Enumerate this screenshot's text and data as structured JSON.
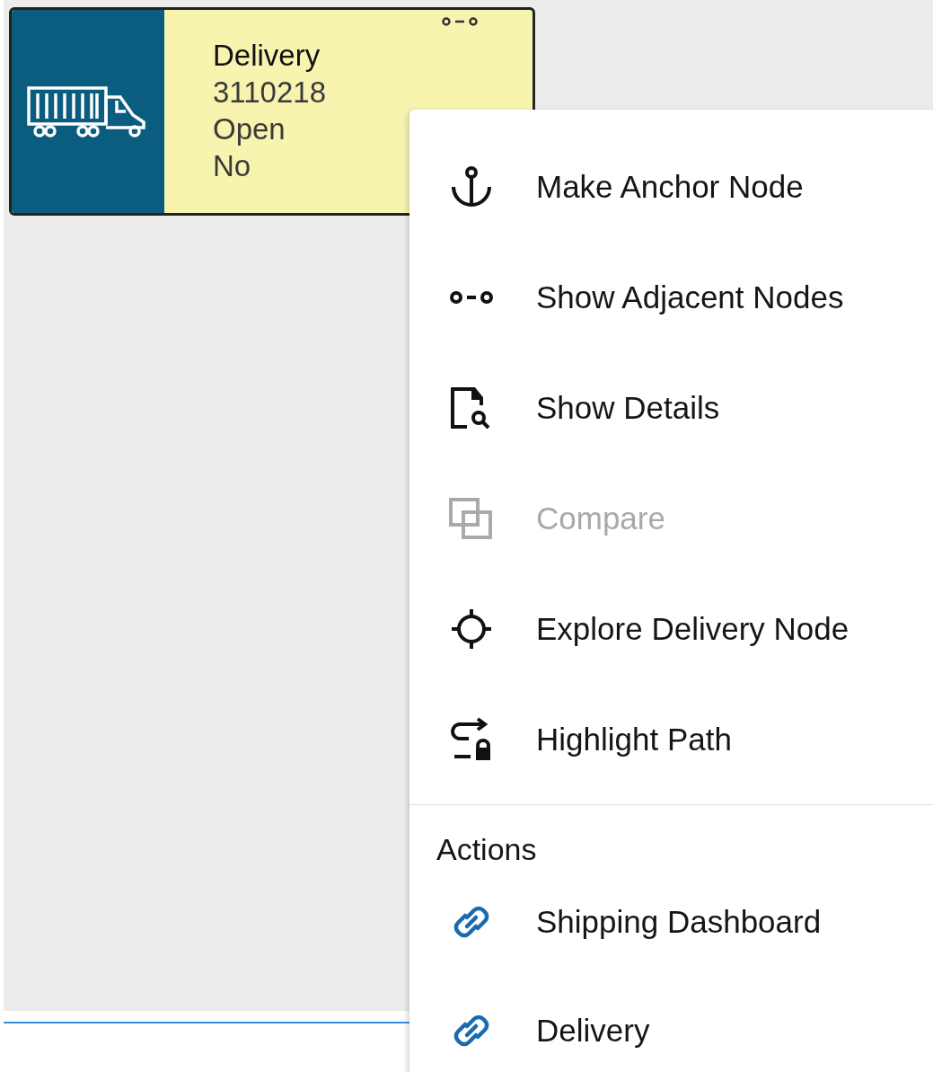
{
  "node": {
    "lines": [
      "Delivery",
      "3110218",
      "Open",
      "No"
    ]
  },
  "context_menu": {
    "items": [
      {
        "label": "Make Anchor Node",
        "disabled": false
      },
      {
        "label": "Show Adjacent Nodes",
        "disabled": false
      },
      {
        "label": "Show Details",
        "disabled": false
      },
      {
        "label": "Compare",
        "disabled": true
      },
      {
        "label": "Explore Delivery Node",
        "disabled": false
      },
      {
        "label": "Highlight Path",
        "disabled": false
      }
    ],
    "section_title": "Actions",
    "actions": [
      {
        "label": "Shipping Dashboard",
        "kind": "link"
      },
      {
        "label": "Delivery",
        "kind": "link"
      }
    ]
  }
}
